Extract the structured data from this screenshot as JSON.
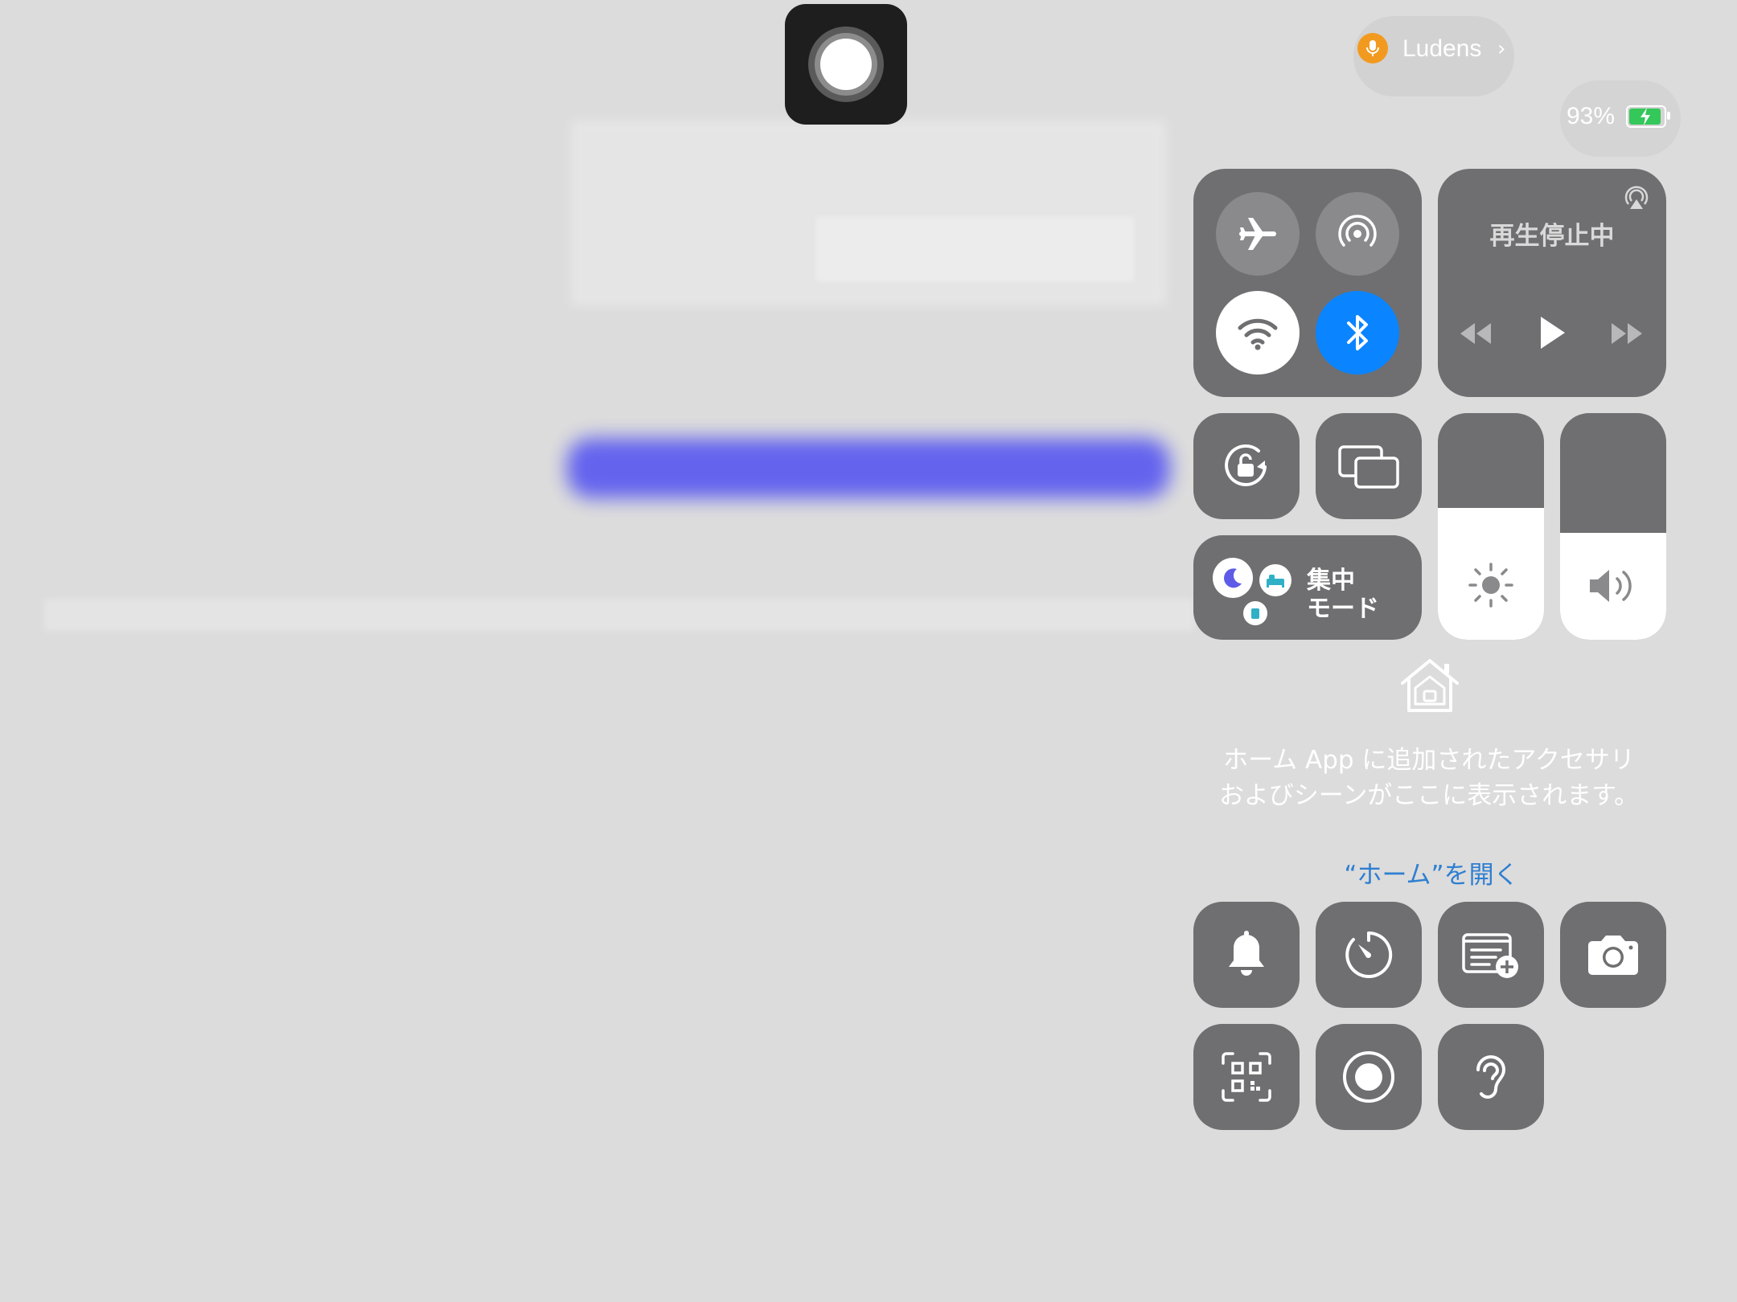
{
  "status": {
    "app_name": "Ludens",
    "battery_percent": "93%",
    "battery_level": 0.93,
    "mic_indicator_color": "#f29a1f"
  },
  "media": {
    "status_label": "再生停止中"
  },
  "focus": {
    "label_line1": "集中",
    "label_line2": "モード"
  },
  "sliders": {
    "brightness_level": 0.58,
    "volume_level": 0.47
  },
  "home": {
    "message": "ホーム App に追加されたアクセサリおよびシーンがここに表示されます。",
    "open_link": "“ホーム”を開く"
  },
  "colors": {
    "accent_blue": "#0a84ff",
    "link_blue": "#2f7fd1",
    "tile_gray": "#6f6f71",
    "background": "#dcdcdc"
  },
  "icons": {
    "airplane": "airplane-icon",
    "airdrop": "airdrop-icon",
    "wifi": "wifi-icon",
    "bluetooth": "bluetooth-icon",
    "airplay": "airplay-icon",
    "rotation_lock": "rotation-lock-icon",
    "screen_mirroring": "screen-mirroring-icon",
    "brightness": "sun-icon",
    "volume": "speaker-icon",
    "home": "home-icon",
    "silent": "bell-icon",
    "timer": "timer-icon",
    "quick_note": "quick-note-icon",
    "camera": "camera-icon",
    "code_scanner": "qr-code-icon",
    "screen_recording": "record-icon",
    "hearing": "ear-icon"
  }
}
